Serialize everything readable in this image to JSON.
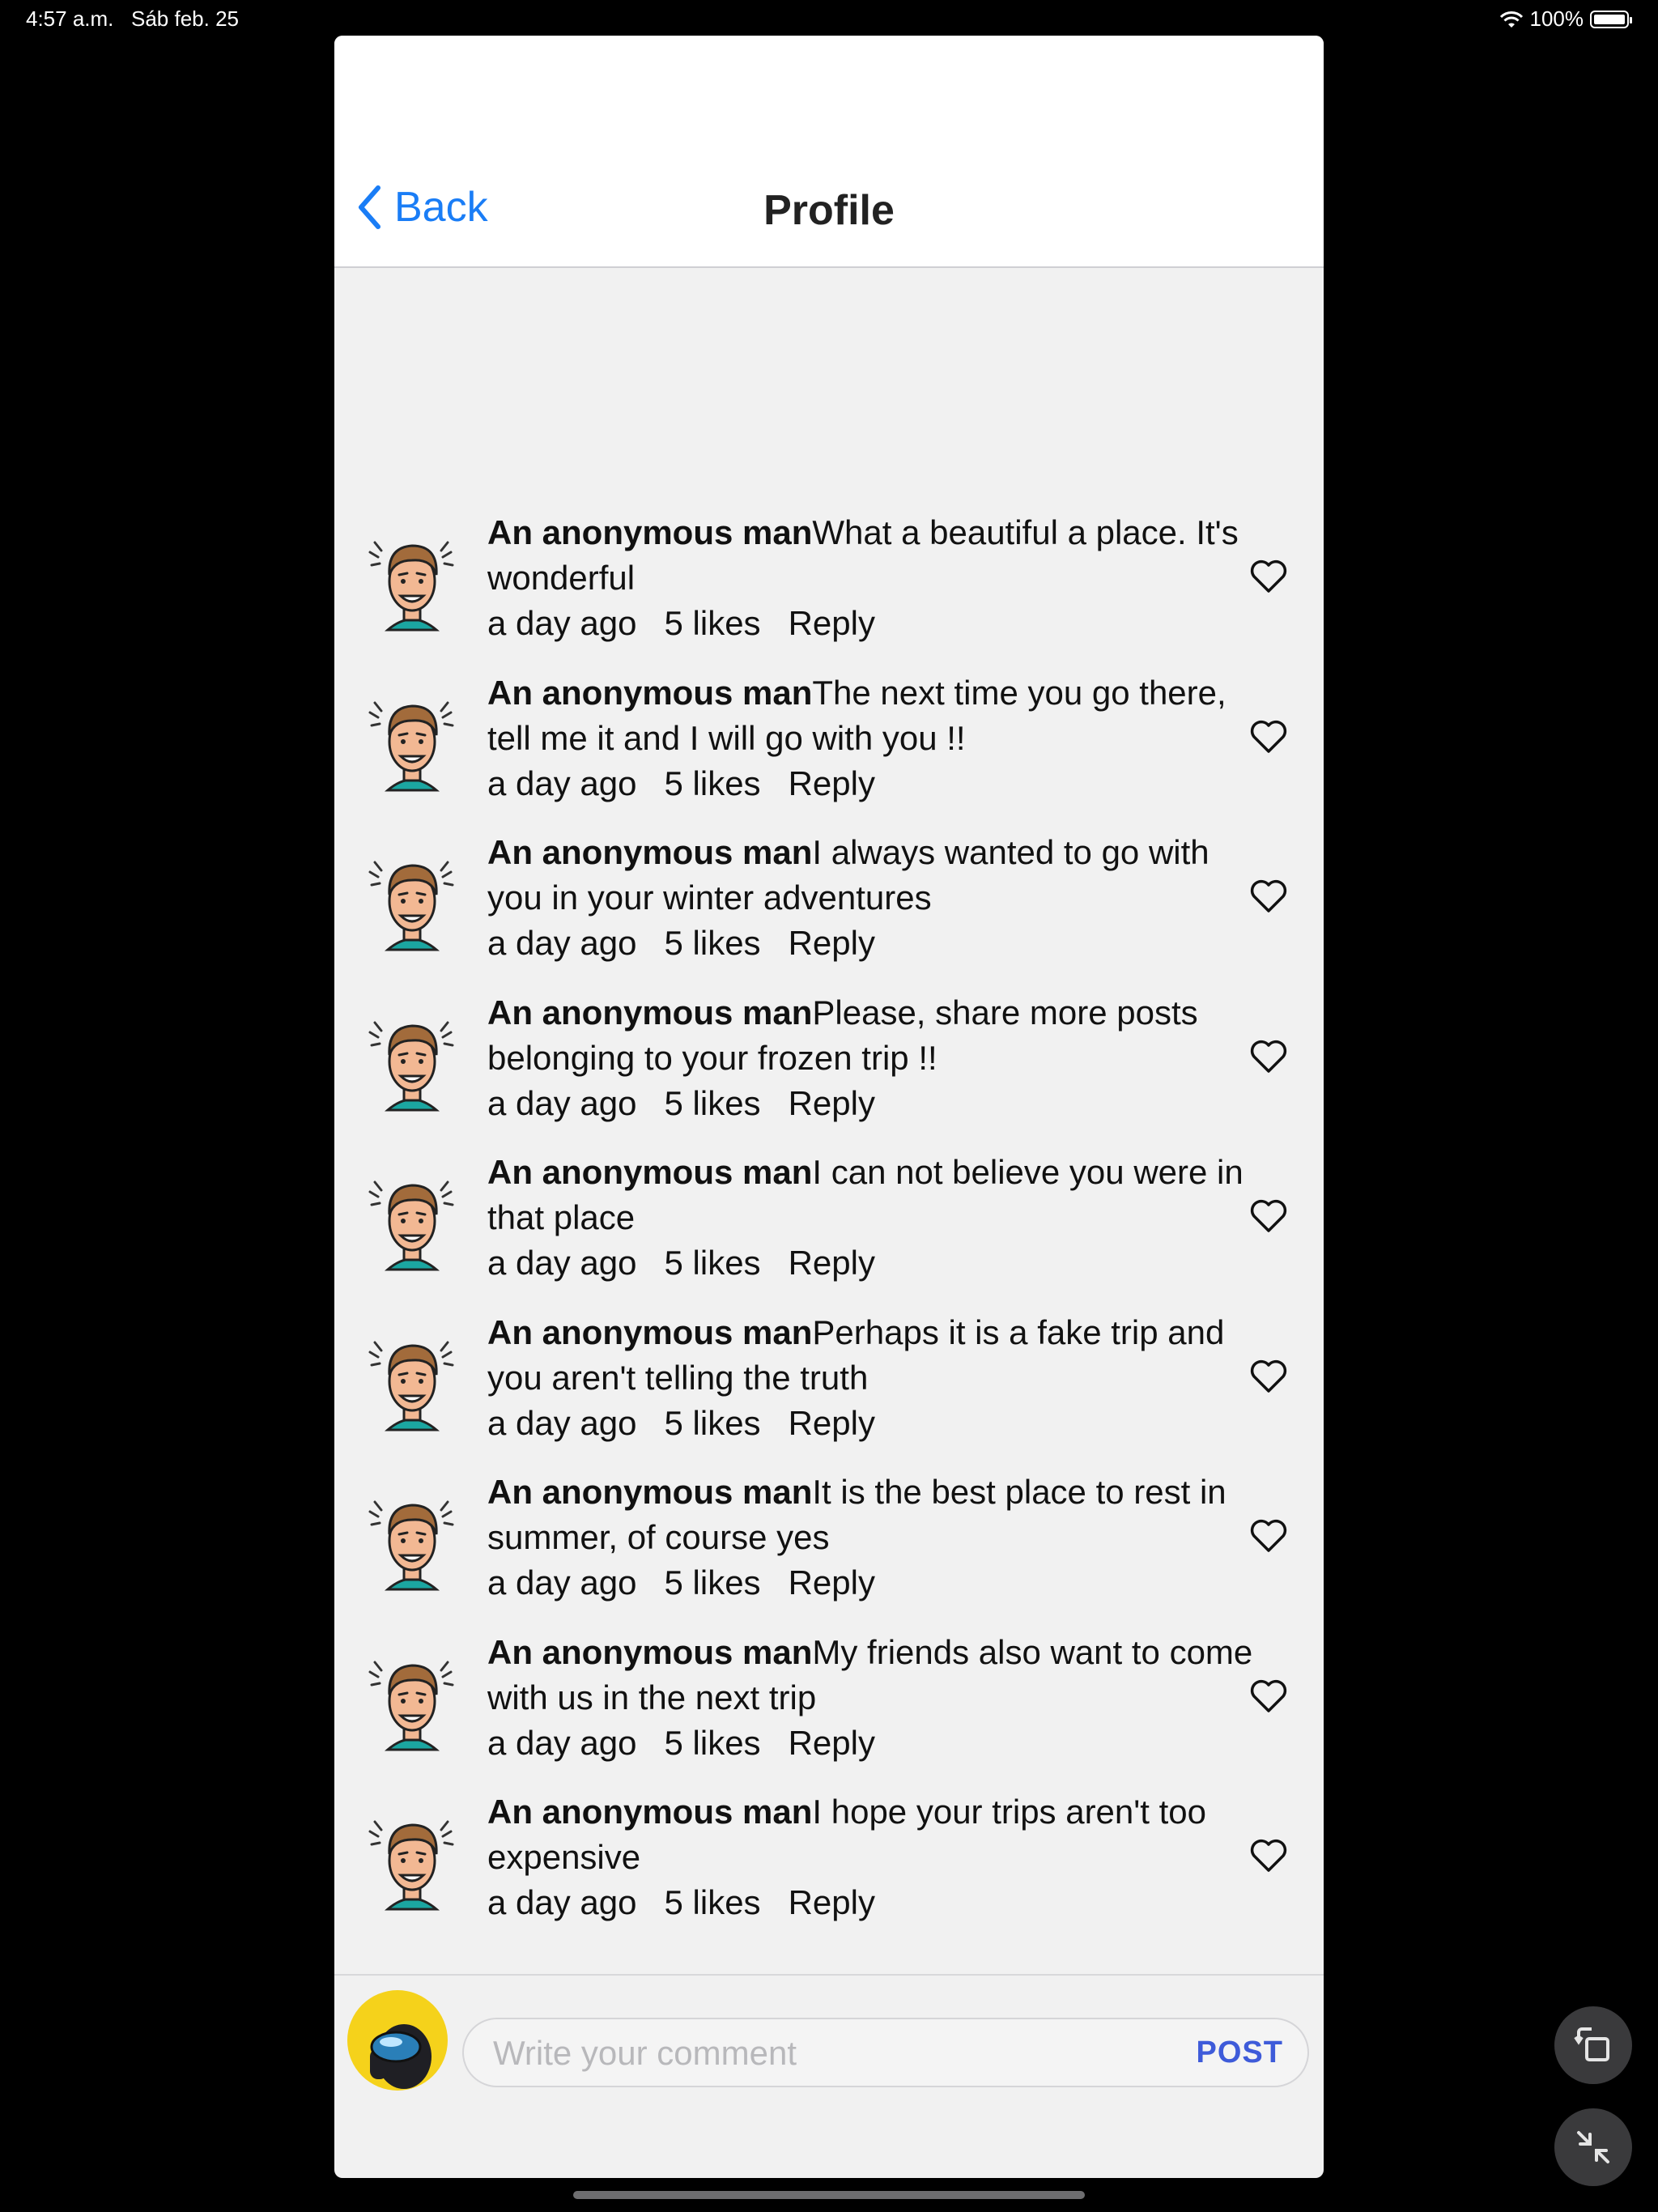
{
  "status_bar": {
    "time": "4:57 a.m.",
    "date": "Sáb feb. 25",
    "battery": "100%"
  },
  "nav": {
    "back_label": "Back",
    "title": "Profile"
  },
  "comments": [
    {
      "author": "An anonymous man",
      "text": "What a beautiful a place. It's wonderful",
      "time": "a day ago",
      "likes": "5 likes",
      "reply": "Reply"
    },
    {
      "author": "An anonymous man",
      "text": "The next time you go there, tell me it and I will go with you !!",
      "time": "a day ago",
      "likes": "5 likes",
      "reply": "Reply"
    },
    {
      "author": "An anonymous man",
      "text": "I always wanted to go with you in your winter adventures",
      "time": "a day ago",
      "likes": "5 likes",
      "reply": "Reply"
    },
    {
      "author": "An anonymous man",
      "text": "Please, share more posts belonging to your frozen trip !!",
      "time": "a day ago",
      "likes": "5 likes",
      "reply": "Reply"
    },
    {
      "author": "An anonymous man",
      "text": "I can not believe you were in that place",
      "time": "a day ago",
      "likes": "5 likes",
      "reply": "Reply"
    },
    {
      "author": "An anonymous man",
      "text": "Perhaps it is a fake trip and you aren't telling the truth",
      "time": "a day ago",
      "likes": "5 likes",
      "reply": "Reply"
    },
    {
      "author": "An anonymous man",
      "text": "It is the best place to rest in summer, of course yes",
      "time": "a day ago",
      "likes": "5 likes",
      "reply": "Reply"
    },
    {
      "author": "An anonymous man",
      "text": "My friends also want to come with us in the next trip",
      "time": "a day ago",
      "likes": "5 likes",
      "reply": "Reply"
    },
    {
      "author": "An anonymous man",
      "text": "I hope your trips aren't too expensive",
      "time": "a day ago",
      "likes": "5 likes",
      "reply": "Reply"
    }
  ],
  "composer": {
    "placeholder": "Write your comment",
    "post_label": "POST"
  },
  "colors": {
    "accent_blue": "#1a7df6",
    "post_blue": "#3e5bd9",
    "avatar_bg": "#f5d21b",
    "background": "#f1f1f1"
  }
}
